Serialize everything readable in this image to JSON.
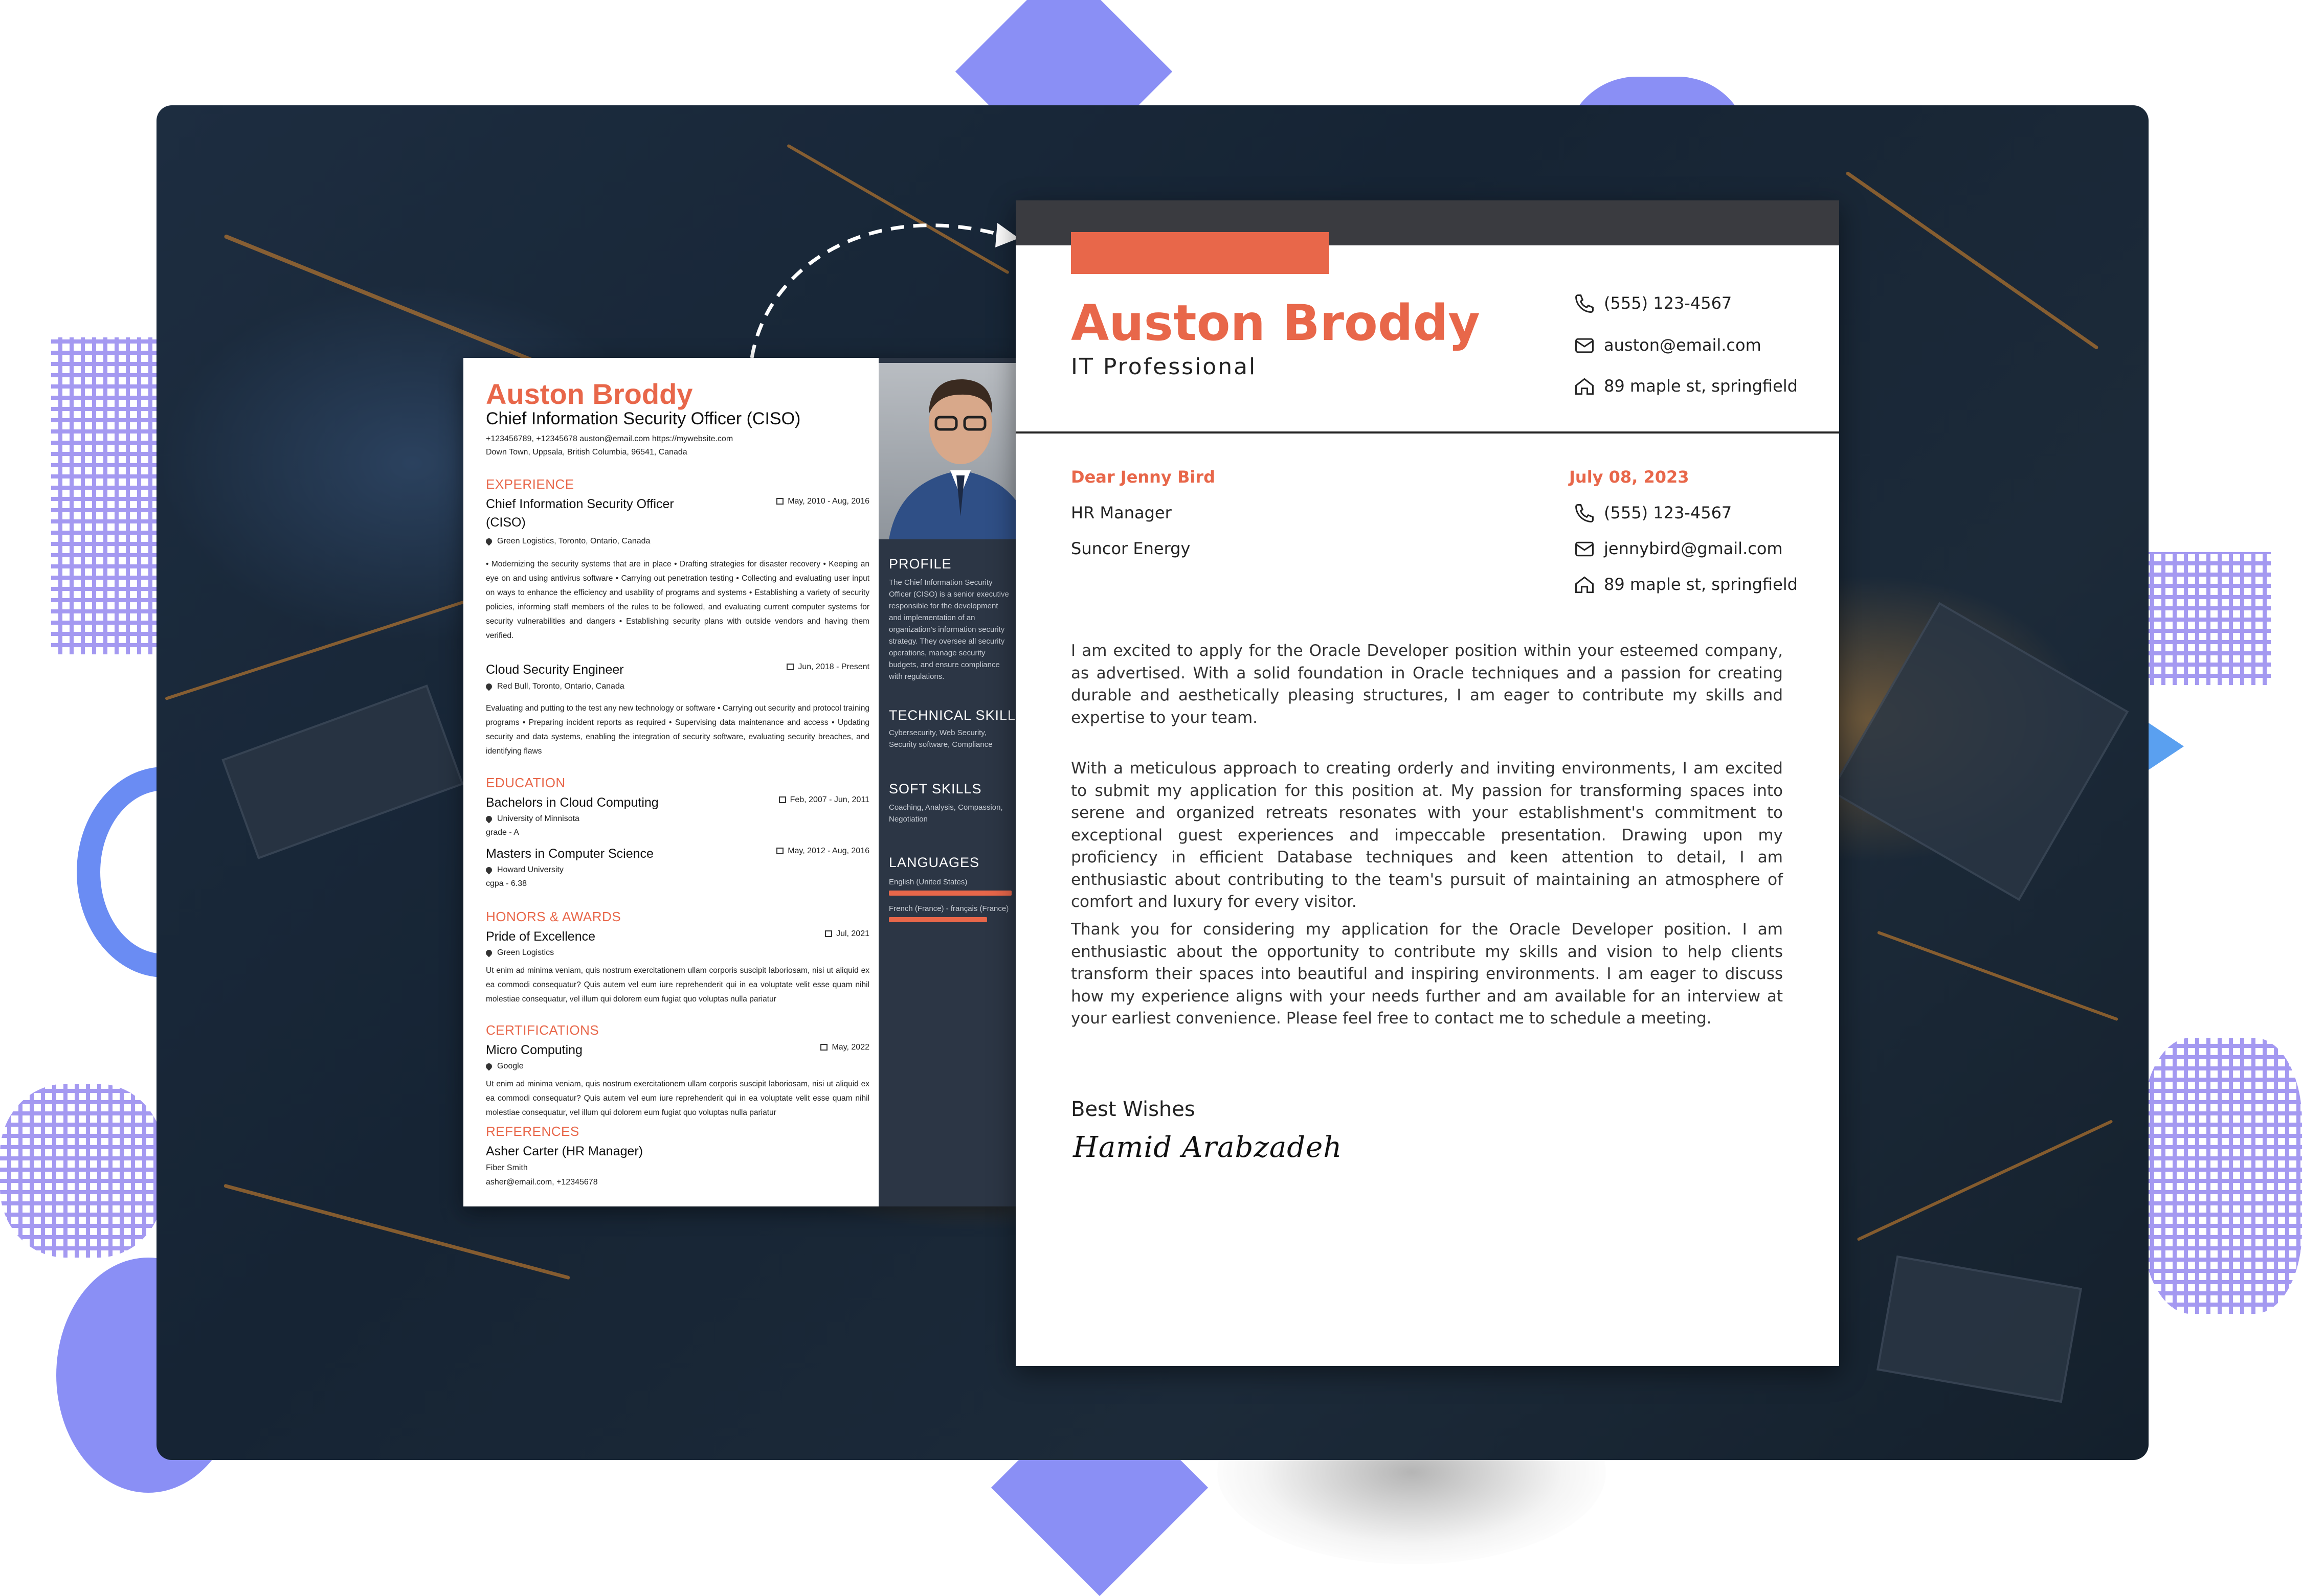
{
  "resume": {
    "name": "Auston Broddy",
    "title": "Chief Information Security Officer (CISO)",
    "contact_line": "+123456789, +12345678   auston@email.com   https://mywebsite.com",
    "location_line": "Down Town, Uppsala, British Columbia, 96541, Canada",
    "sections": {
      "experience": "EXPERIENCE",
      "education": "EDUCATION",
      "honors": "HONORS & AWARDS",
      "certifications": "CERTIFICATIONS",
      "references": "REFERENCES"
    },
    "experience": [
      {
        "role": "Chief Information Security Officer",
        "role_cont": "(CISO)",
        "date": "May, 2010 - Aug, 2016",
        "place": "Green Logistics, Toronto, Ontario, Canada",
        "desc": "• Modernizing the security systems that are in place • Drafting strategies for disaster recovery • Keeping an eye on and using antivirus software • Carrying out penetration testing • Collecting and evaluating user input on ways to enhance the efficiency and usability of programs and systems • Establishing a variety of security policies, informing staff members of the rules to be followed, and evaluating current computer systems for security vulnerabilities and dangers • Establishing security plans with outside vendors and having them verified."
      },
      {
        "role": "Cloud Security Engineer",
        "date": "Jun, 2018 - Present",
        "place": "Red Bull, Toronto, Ontario, Canada",
        "desc": "Evaluating and putting to the test any new technology or software • Carrying out security and protocol training programs • Preparing incident reports as required • Supervising data maintenance and access • Updating security and data systems, enabling the integration of security software, evaluating security breaches, and identifying flaws"
      }
    ],
    "education": [
      {
        "degree": "Bachelors in Cloud Computing",
        "date": "Feb, 2007 - Jun, 2011",
        "school": "University of Minnisota",
        "grade": "grade - A"
      },
      {
        "degree": "Masters in Computer Science",
        "date": "May, 2012 - Aug, 2016",
        "school": "Howard University",
        "grade": "cgpa - 6.38"
      }
    ],
    "honor": {
      "name": "Pride of Excellence",
      "date": "Jul, 2021",
      "org": "Green Logistics",
      "desc": "Ut enim ad minima veniam, quis nostrum exercitationem ullam corporis suscipit laboriosam, nisi ut aliquid ex ea commodi consequatur? Quis autem vel eum iure reprehenderit qui in ea voluptate velit esse quam nihil molestiae consequatur, vel illum qui dolorem eum fugiat quo voluptas nulla pariatur"
    },
    "certification": {
      "name": "Micro Computing",
      "date": "May, 2022",
      "org": "Google",
      "desc": "Ut enim ad minima veniam, quis nostrum exercitationem ullam corporis suscipit laboriosam, nisi ut aliquid ex ea commodi consequatur? Quis autem vel eum iure reprehenderit qui in ea voluptate velit esse quam nihil molestiae consequatur, vel illum qui dolorem eum fugiat quo voluptas nulla pariatur"
    },
    "reference": {
      "name": "Asher Carter (HR Manager)",
      "company": "Fiber Smith",
      "contact": "asher@email.com, +12345678"
    },
    "sidebar": {
      "profile_h": "PROFILE",
      "profile_t": "The Chief Information Security Officer (CISO) is a senior executive responsible for the development and implementation of an organization's information security strategy. They oversee all security operations, manage security budgets, and ensure compliance with regulations.",
      "tech_h": "TECHNICAL SKILLS",
      "tech_t": "Cybersecurity, Web Security, Security software, Compliance",
      "soft_h": "SOFT SKILLS",
      "soft_t": "Coaching, Analysis, Compassion, Negotiation",
      "lang_h": "LANGUAGES",
      "languages": [
        {
          "name": "English (United States)",
          "level": 1.0
        },
        {
          "name": "French (France) - français (France)",
          "level": 0.8
        }
      ]
    }
  },
  "letter": {
    "name": "Auston Broddy",
    "role": "IT Professional",
    "contacts": {
      "phone": "(555) 123-4567",
      "email": "auston@email.com",
      "address": "89 maple st, springfield"
    },
    "recipient": {
      "greeting": "Dear Jenny Bird",
      "title": "HR Manager",
      "company": "Suncor Energy",
      "date": "July 08, 2023",
      "phone": "(555) 123-4567",
      "email": "jennybird@gmail.com",
      "address": "89 maple st, springfield"
    },
    "paragraphs": [
      "I am excited to apply for the Oracle Developer position within your esteemed company, as advertised. With a solid foundation in Oracle techniques and a passion for creating durable and aesthetically pleasing structures, I am eager to contribute my skills and expertise to your team.",
      "With a meticulous approach to creating orderly and inviting environments, I am excited to submit my application for this position at. My passion for transforming spaces into serene and organized retreats resonates with your establishment's commitment to exceptional guest experiences and impeccable presentation. Drawing upon my proficiency in efficient Database techniques and keen attention to detail, I am enthusiastic about contributing to the team's pursuit of maintaining an atmosphere of comfort and luxury for every visitor.",
      "Thank you for considering my application for the Oracle Developer position. I am enthusiastic about the opportunity to contribute my skills and vision to help clients transform their spaces into beautiful and inspiring environments. I am eager to discuss how my experience aligns with your needs further and am available for an interview at your earliest convenience. Please feel free to contact me to schedule a meeting."
    ],
    "closing": "Best Wishes",
    "signature": "Hamid Arabzadeh"
  },
  "colors": {
    "accent": "#e8674a",
    "sidebar": "#2c3645",
    "deco": "#8a8ff5"
  }
}
